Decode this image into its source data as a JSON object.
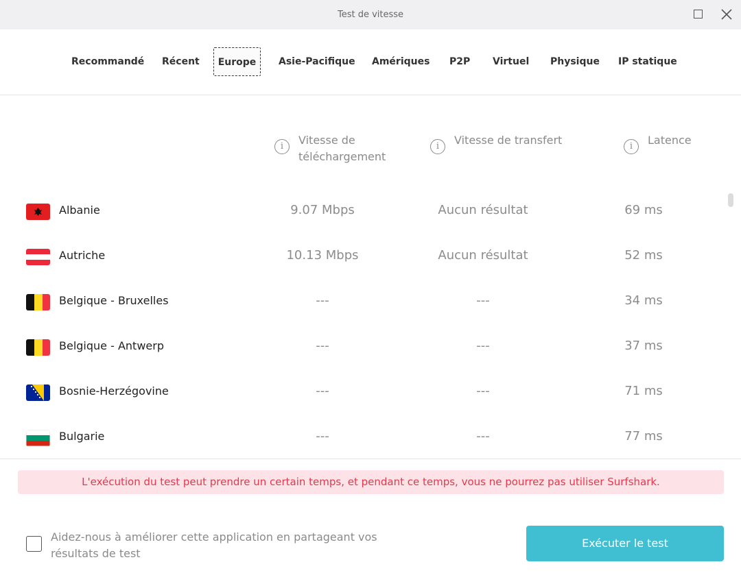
{
  "window": {
    "title": "Test de vitesse"
  },
  "tabs": [
    {
      "label": "Recommandé"
    },
    {
      "label": "Récent"
    },
    {
      "label": "Europe"
    },
    {
      "label": "Asie-Pacifique"
    },
    {
      "label": "Amériques"
    },
    {
      "label": "P2P"
    },
    {
      "label": "Virtuel"
    },
    {
      "label": "Physique"
    },
    {
      "label": "IP statique"
    }
  ],
  "active_tab": "Europe",
  "columns": {
    "download": {
      "line1": "Vitesse de",
      "line2": "téléchargement"
    },
    "upload": {
      "line1": "Vitesse de transfert"
    },
    "latency": {
      "line1": "Latence"
    },
    "info_glyph": "i"
  },
  "rows": [
    {
      "country": "Albanie",
      "download": "9.07 Mbps",
      "upload": "Aucun résultat",
      "latency": "69 ms",
      "flag_icon": "flag-albania-icon"
    },
    {
      "country": "Autriche",
      "download": "10.13 Mbps",
      "upload": "Aucun résultat",
      "latency": "52 ms",
      "flag_icon": "flag-austria-icon"
    },
    {
      "country": "Belgique - Bruxelles",
      "download": "---",
      "upload": "---",
      "latency": "34 ms",
      "flag_icon": "flag-belgium-icon"
    },
    {
      "country": "Belgique - Antwerp",
      "download": "---",
      "upload": "---",
      "latency": "37 ms",
      "flag_icon": "flag-belgium-icon"
    },
    {
      "country": "Bosnie-Herzégovine",
      "download": "---",
      "upload": "---",
      "latency": "71 ms",
      "flag_icon": "flag-bosnia-icon"
    },
    {
      "country": "Bulgarie",
      "download": "---",
      "upload": "---",
      "latency": "77 ms",
      "flag_icon": "flag-bulgaria-icon"
    }
  ],
  "warning": {
    "text": "L'exécution du test peut prendre un certain temps, et pendant ce temps, vous ne pourrez pas utiliser Surfshark."
  },
  "consent": {
    "line1": "Aidez-nous à améliorer cette application en partageant vos",
    "line2": "résultats de test",
    "checked": false
  },
  "run_button": {
    "label": "Exécuter le test"
  },
  "colors": {
    "accent": "#40bfd2",
    "warning_bg": "#fde3e7",
    "warning_text": "#e5384a"
  }
}
